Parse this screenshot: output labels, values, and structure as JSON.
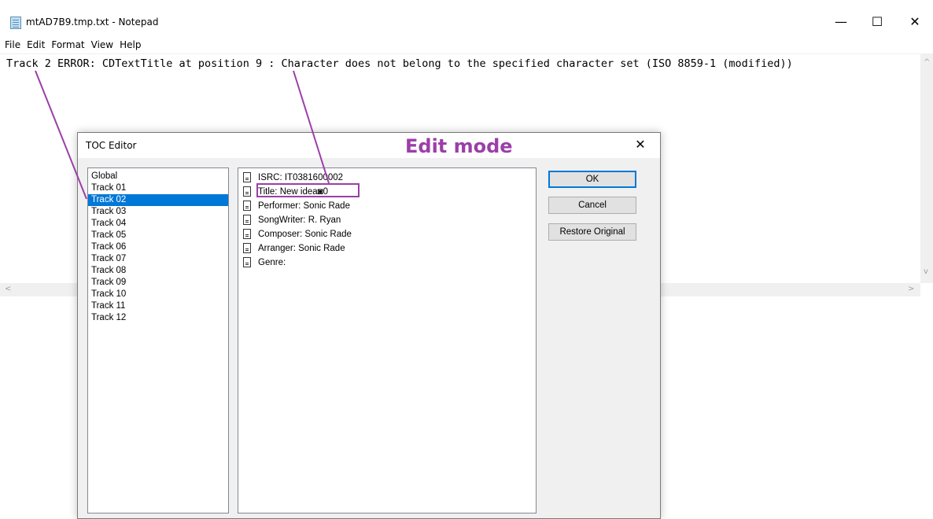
{
  "notepad": {
    "title": "mtAD7B9.tmp.txt - Notepad",
    "window_buttons": {
      "minimize": "—",
      "maximize": "☐",
      "close": "✕"
    },
    "menu": [
      "File",
      "Edit",
      "Format",
      "View",
      "Help"
    ],
    "content": "Track 2 ERROR: CDTextTitle at position 9 : Character does not belong to the specified character set (ISO 8859-1 (modified))",
    "scroll_arrows": {
      "up": "^",
      "down": "v",
      "left": "<",
      "right": ">"
    }
  },
  "dialog": {
    "title": "TOC Editor",
    "close_glyph": "✕",
    "tracks": [
      "Global",
      "Track 01",
      "Track 02",
      "Track 03",
      "Track 04",
      "Track 05",
      "Track 06",
      "Track 07",
      "Track 08",
      "Track 09",
      "Track 10",
      "Track 11",
      "Track 12"
    ],
    "selected_track": "Track 02",
    "fields": [
      "ISRC: IT0381600002",
      "Title: New idea◙0",
      "Performer: Sonic Rade",
      "SongWriter: R. Ryan",
      "Composer: Sonic Rade",
      "Arranger: Sonic Rade",
      "Genre:"
    ],
    "buttons": {
      "ok": "OK",
      "cancel": "Cancel",
      "restore": "Restore Original"
    }
  },
  "annotation": {
    "label": "Edit mode",
    "color": "#9b3fa8"
  },
  "colors": {
    "selection": "#0078d7",
    "default_button_border": "#0078d7"
  }
}
